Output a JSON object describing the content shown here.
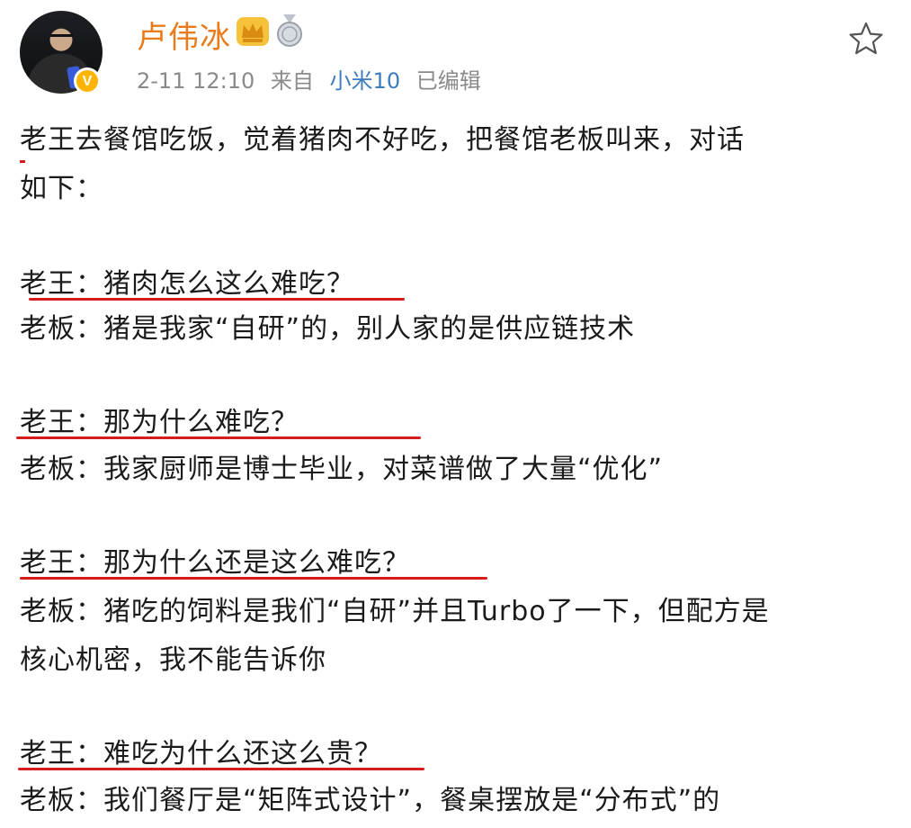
{
  "author": {
    "name": "卢伟冰",
    "verified_badge": "V",
    "icons": [
      "crown-icon",
      "medal-icon"
    ]
  },
  "meta": {
    "time": "2-11 12:10",
    "from_label": "来自",
    "device": "小米10",
    "edited": "已编辑"
  },
  "actions": {
    "favorite_icon": "star-icon"
  },
  "post": {
    "lines": [
      "老王去餐馆吃饭，觉着猪肉不好吃，把餐馆老板叫来，对话",
      "如下：",
      "老王：猪肉怎么这么难吃？",
      "老板：猪是我家“自研”的，别人家的是供应链技术",
      "老王：那为什么难吃？",
      "老板：我家厨师是博士毕业，对菜谱做了大量“优化”",
      "老王：那为什么还是这么难吃？",
      "老板：猪吃的饲料是我们“自研”并且Turbo了一下，但配方是",
      "核心机密，我不能告诉你",
      "老王：难吃为什么还这么贵？",
      "老板：我们餐厅是“矩阵式设计”，餐桌摆放是“分布式”的"
    ]
  },
  "colors": {
    "username": "#ea7a1a",
    "device_link": "#3d7bbf",
    "meta_text": "#8a8a8a",
    "annotation": "#d61c1c",
    "body_text": "#1b1b1b"
  }
}
